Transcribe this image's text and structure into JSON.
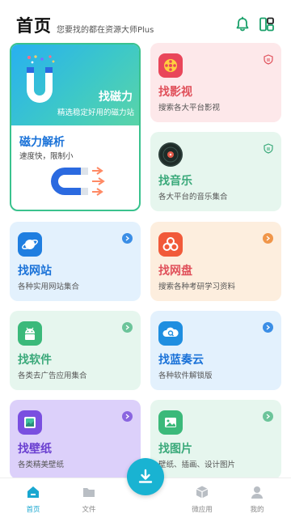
{
  "header": {
    "title": "首页",
    "subtitle": "您要找的都在资源大师Plus"
  },
  "magnet_card": {
    "title": "找磁力",
    "desc": "精选稳定好用的磁力站",
    "sub_title": "磁力解析",
    "sub_desc": "速度快，限制小"
  },
  "cards": [
    {
      "id": "video",
      "title": "找影视",
      "desc": "搜索各大平台影视",
      "title_color": "#e0505a",
      "icon": "film-reel-icon",
      "badge": "shield-badge-icon"
    },
    {
      "id": "music",
      "title": "找音乐",
      "desc": "各大平台的音乐集合",
      "title_color": "#3aa97a",
      "icon": "vinyl-disc-icon",
      "badge": "shield-badge-icon"
    },
    {
      "id": "site",
      "title": "找网站",
      "desc": "各种实用网站集合",
      "title_color": "#1a72d8",
      "icon": "planet-icon"
    },
    {
      "id": "pan",
      "title": "找网盘",
      "desc": "搜索各种考研学习资料",
      "title_color": "#e0505a",
      "icon": "cloud-drive-icon"
    },
    {
      "id": "software",
      "title": "找软件",
      "desc": "各类去广告应用集合",
      "title_color": "#3aa97a",
      "icon": "android-icon"
    },
    {
      "id": "lanzou",
      "title": "找蓝奏云",
      "desc": "各种软件解锁版",
      "title_color": "#1a72d8",
      "icon": "search-cloud-icon"
    },
    {
      "id": "wallpaper",
      "title": "找壁纸",
      "desc": "各类精美壁纸",
      "title_color": "#6a3fd0",
      "icon": "wallpaper-icon"
    },
    {
      "id": "picture",
      "title": "找图片",
      "desc": "壁纸、插画、设计图片",
      "title_color": "#3aa97a",
      "icon": "picture-icon"
    }
  ],
  "nav": {
    "items": [
      {
        "label": "首页",
        "icon": "home-icon"
      },
      {
        "label": "文件",
        "icon": "file-icon"
      },
      {
        "label": "微应用",
        "icon": "cube-icon"
      },
      {
        "label": "我的",
        "icon": "user-icon"
      }
    ],
    "fab_icon": "download-icon"
  },
  "colors": {
    "accent": "#19b3d2",
    "magnet_gradient": [
      "#28b0f0",
      "#5ad4a8"
    ],
    "card_red": "#fde8ea",
    "card_green": "#e6f6ee",
    "card_blue": "#e3f1fd",
    "card_orange": "#fdeede",
    "card_purple": "#dcd0fa"
  }
}
